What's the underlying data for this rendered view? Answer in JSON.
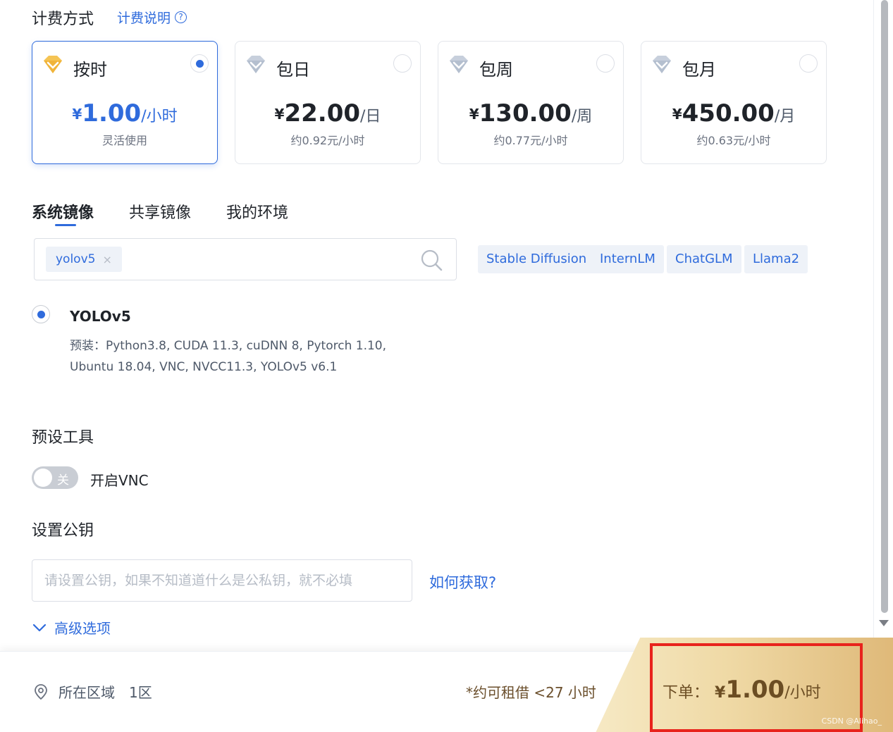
{
  "billing": {
    "title": "计费方式",
    "help_link": "计费说明",
    "help_icon_glyph": "?",
    "plans": [
      {
        "name": "按时",
        "currency": "¥",
        "amount": "1.00",
        "unit": "/小时",
        "sub": "灵活使用",
        "selected": true,
        "icon": "gold-diamond-icon"
      },
      {
        "name": "包日",
        "currency": "¥",
        "amount": "22.00",
        "unit": "/日",
        "sub": "约0.92元/小时",
        "selected": false,
        "icon": "silver-diamond-icon"
      },
      {
        "name": "包周",
        "currency": "¥",
        "amount": "130.00",
        "unit": "/周",
        "sub": "约0.77元/小时",
        "selected": false,
        "icon": "silver-diamond-icon"
      },
      {
        "name": "包月",
        "currency": "¥",
        "amount": "450.00",
        "unit": "/月",
        "sub": "约0.63元/小时",
        "selected": false,
        "icon": "silver-diamond-icon"
      }
    ]
  },
  "images": {
    "tabs": [
      "系统镜像",
      "共享镜像",
      "我的环境"
    ],
    "active_tab": 0,
    "search_tag": "yolov5",
    "search_tag_close": "×",
    "quick_tags": [
      "Stable Diffusion",
      "InternLM",
      "ChatGLM",
      "Llama2"
    ],
    "selected": {
      "name": "YOLOv5",
      "desc_line1": "预装：Python3.8, CUDA 11.3, cuDNN 8, Pytorch 1.10,",
      "desc_line2": "Ubuntu 18.04, VNC, NVCC11.3, YOLOv5 v6.1"
    }
  },
  "tools": {
    "title": "预设工具",
    "vnc_toggle_text": "关",
    "vnc_label": "开启VNC",
    "vnc_enabled": false
  },
  "public_key": {
    "title": "设置公钥",
    "placeholder": "请设置公钥，如果不知道道什么是公私钥，就不必填",
    "value": "",
    "how_link": "如何获取?"
  },
  "advanced": {
    "label": "高级选项"
  },
  "footer": {
    "region_label": "所在区域",
    "region_value": "1区",
    "rent_note": "*约可租借 <27 小时",
    "order_label": "下单：",
    "order_currency": "¥",
    "order_amount": "1.00",
    "order_unit": "/小时",
    "watermark": "CSDN @Alihao_"
  },
  "colors": {
    "accent": "#2f6bdc",
    "highlight_border": "#e8231c",
    "order_gradient_start": "#f6e9c4",
    "order_gradient_end": "#dfb979"
  }
}
